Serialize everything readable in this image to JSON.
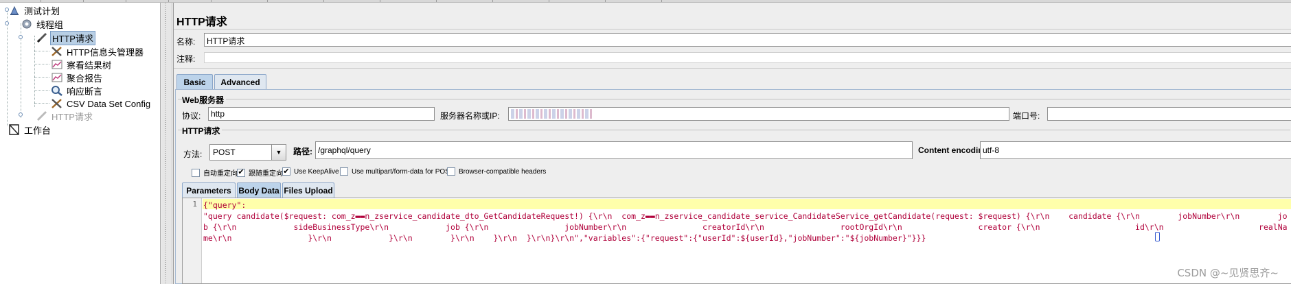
{
  "tree": {
    "items": [
      {
        "label": "测试计划",
        "icon": "test-plan-icon"
      },
      {
        "label": "线程组",
        "icon": "thread-group-gear-icon"
      },
      {
        "label": "HTTP请求",
        "icon": "sampler-pencil-icon",
        "selected": true
      },
      {
        "label": "HTTP信息头管理器",
        "icon": "config-tools-icon"
      },
      {
        "label": "察看结果树",
        "icon": "listener-graph-icon"
      },
      {
        "label": "聚合报告",
        "icon": "listener-graph-icon"
      },
      {
        "label": "响应断言",
        "icon": "assertion-magnifier-icon"
      },
      {
        "label": "CSV Data Set Config",
        "icon": "config-tools-icon"
      },
      {
        "label": "HTTP请求",
        "icon": "sampler-pencil-icon",
        "disabled": true
      },
      {
        "label": "工作台",
        "icon": "workbench-icon"
      }
    ]
  },
  "panel": {
    "title": "HTTP请求",
    "name_label": "名称:",
    "name_value": "HTTP请求",
    "comment_label": "注释:",
    "comment_value": "",
    "tabs": [
      "Basic",
      "Advanced"
    ],
    "web_server": {
      "group_title": "Web服务器",
      "protocol_label": "协议:",
      "protocol_value": "http",
      "server_label": "服务器名称或IP:",
      "port_label": "端口号:",
      "port_value": ""
    },
    "http_request": {
      "group_title": "HTTP请求",
      "method_label": "方法:",
      "method_value": "POST",
      "path_label": "路径:",
      "path_value": "/graphql/query",
      "encoding_label": "Content encoding:",
      "encoding_value": "utf-8"
    },
    "checkboxes": [
      {
        "label": "自动重定向",
        "checked": false
      },
      {
        "label": "跟随重定向",
        "checked": true
      },
      {
        "label": "Use KeepAlive",
        "checked": true
      },
      {
        "label": "Use multipart/form-data for POST",
        "checked": false
      },
      {
        "label": "Browser-compatible headers",
        "checked": false
      }
    ],
    "body_tabs": [
      "Parameters",
      "Body Data",
      "Files Upload"
    ],
    "active_body_tab": "Body Data",
    "editor": {
      "line_number": "1",
      "code": "{\"query\":\n\"query candidate($request: com_z▬▬n_zservice_candidate_dto_GetCandidateRequest!) {\\r\\n  com_z▬▬n_zservice_candidate_service_CandidateService_getCandidate(request: $request) {\\r\\n    candidate {\\r\\n        jobNumber\\r\\n        job {\\r\\n            sideBusinessType\\r\\n            job {\\r\\n                jobNumber\\r\\n                creatorId\\r\\n                rootOrgId\\r\\n                creator {\\r\\n                    id\\r\\n                    realName\\r\\n                }\\r\\n            }\\r\\n        }\\r\\n    }\\r\\n  }\\r\\n}\\r\\n\",\"variables\":{\"request\":{\"userId\":${userId},\"jobNumber\":\"${jobNumber}\"}}}"
    }
  },
  "watermark": "CSDN @~见贤思齐~"
}
